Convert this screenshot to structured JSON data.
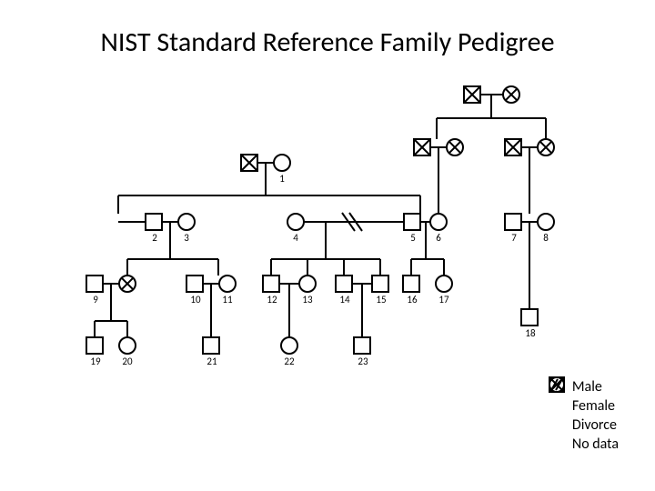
{
  "title": "NIST Standard Reference Family Pedigree",
  "legend": {
    "male": "Male",
    "female": "Female",
    "divorce": "Divorce",
    "nodata": "No data"
  },
  "people": [
    {
      "id": 1,
      "sex": "F",
      "nodata": false
    },
    {
      "id": 2,
      "sex": "M",
      "nodata": false
    },
    {
      "id": 3,
      "sex": "F",
      "nodata": false
    },
    {
      "id": 4,
      "sex": "F",
      "nodata": false
    },
    {
      "id": 5,
      "sex": "M",
      "nodata": false
    },
    {
      "id": 6,
      "sex": "F",
      "nodata": false
    },
    {
      "id": 7,
      "sex": "M",
      "nodata": false
    },
    {
      "id": 8,
      "sex": "F",
      "nodata": false
    },
    {
      "id": 9,
      "sex": "M",
      "nodata": false
    },
    {
      "id": 10,
      "sex": "M",
      "nodata": false
    },
    {
      "id": 11,
      "sex": "F",
      "nodata": false
    },
    {
      "id": 12,
      "sex": "M",
      "nodata": false
    },
    {
      "id": 13,
      "sex": "F",
      "nodata": false
    },
    {
      "id": 14,
      "sex": "M",
      "nodata": false
    },
    {
      "id": 15,
      "sex": "M",
      "nodata": false
    },
    {
      "id": 16,
      "sex": "M",
      "nodata": false
    },
    {
      "id": 17,
      "sex": "F",
      "nodata": false
    },
    {
      "id": 18,
      "sex": "M",
      "nodata": false
    },
    {
      "id": 19,
      "sex": "M",
      "nodata": false
    },
    {
      "id": 20,
      "sex": "F",
      "nodata": false
    },
    {
      "id": 21,
      "sex": "M",
      "nodata": false
    },
    {
      "id": 22,
      "sex": "F",
      "nodata": false
    },
    {
      "id": 23,
      "sex": "M",
      "nodata": false
    }
  ],
  "founders": [
    {
      "sex": "M",
      "nodata": true
    },
    {
      "sex": "F",
      "nodata": true
    },
    {
      "sex": "M",
      "nodata": true
    },
    {
      "sex": "F",
      "nodata": true
    },
    {
      "sex": "M",
      "nodata": true
    },
    {
      "sex": "F",
      "nodata": true
    },
    {
      "sex": "M",
      "nodata": true
    },
    {
      "sex": "F",
      "nodata": true
    }
  ],
  "couples": [
    {
      "a": "founder-top-M",
      "b": "founder-top-F"
    },
    {
      "a": "founder-mid-L-M",
      "b": 1
    },
    {
      "a": "founder-mid-R1-M",
      "b": "founder-mid-R1-F"
    },
    {
      "a": "founder-mid-R2-M",
      "b": "founder-mid-R2-F"
    },
    {
      "a": 2,
      "b": 3
    },
    {
      "a": 4,
      "b": 5,
      "divorce": true
    },
    {
      "a": 5,
      "b": 6
    },
    {
      "a": 7,
      "b": 8
    },
    {
      "a": 9,
      "b": "nodata-F"
    },
    {
      "a": 10,
      "b": 11
    },
    {
      "a": 12,
      "b": 13
    },
    {
      "a": 14,
      "b": 15
    }
  ]
}
